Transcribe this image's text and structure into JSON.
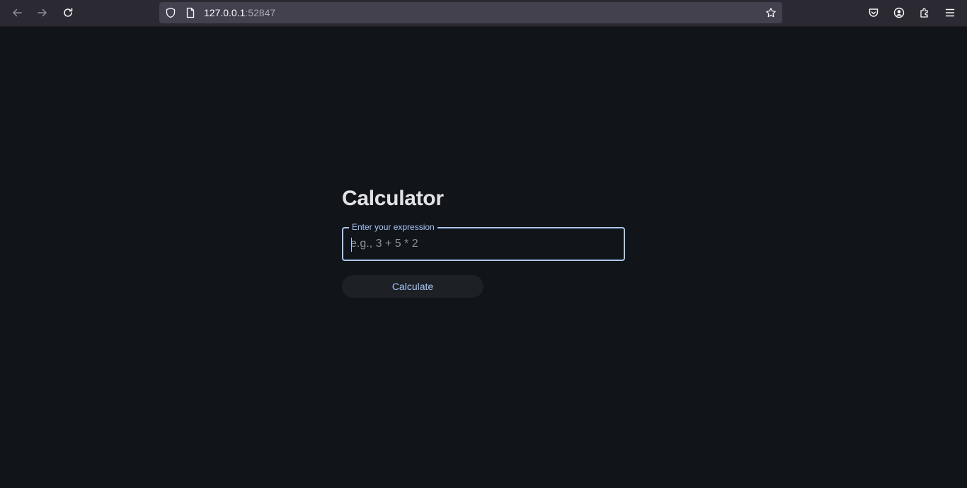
{
  "browser": {
    "url_host": "127.0.0.1",
    "url_port": ":52847",
    "icons": {
      "back": "back-arrow-icon",
      "forward": "forward-arrow-icon",
      "reload": "reload-icon",
      "shield": "tracking-protection-shield-icon",
      "page": "page-document-icon",
      "bookmark": "bookmark-star-icon",
      "pocket": "pocket-icon",
      "account": "account-icon",
      "extensions": "extensions-puzzle-icon",
      "menu": "hamburger-menu-icon"
    }
  },
  "page": {
    "title": "Calculator",
    "expression_field": {
      "label": "Enter your expression",
      "placeholder": "e.g., 3 + 5 * 2",
      "value": ""
    },
    "calculate_button": "Calculate"
  },
  "colors": {
    "background": "#111418",
    "accent": "#a8c7fa",
    "title_text": "#e2e2e6",
    "button_background": "#1d2024"
  }
}
